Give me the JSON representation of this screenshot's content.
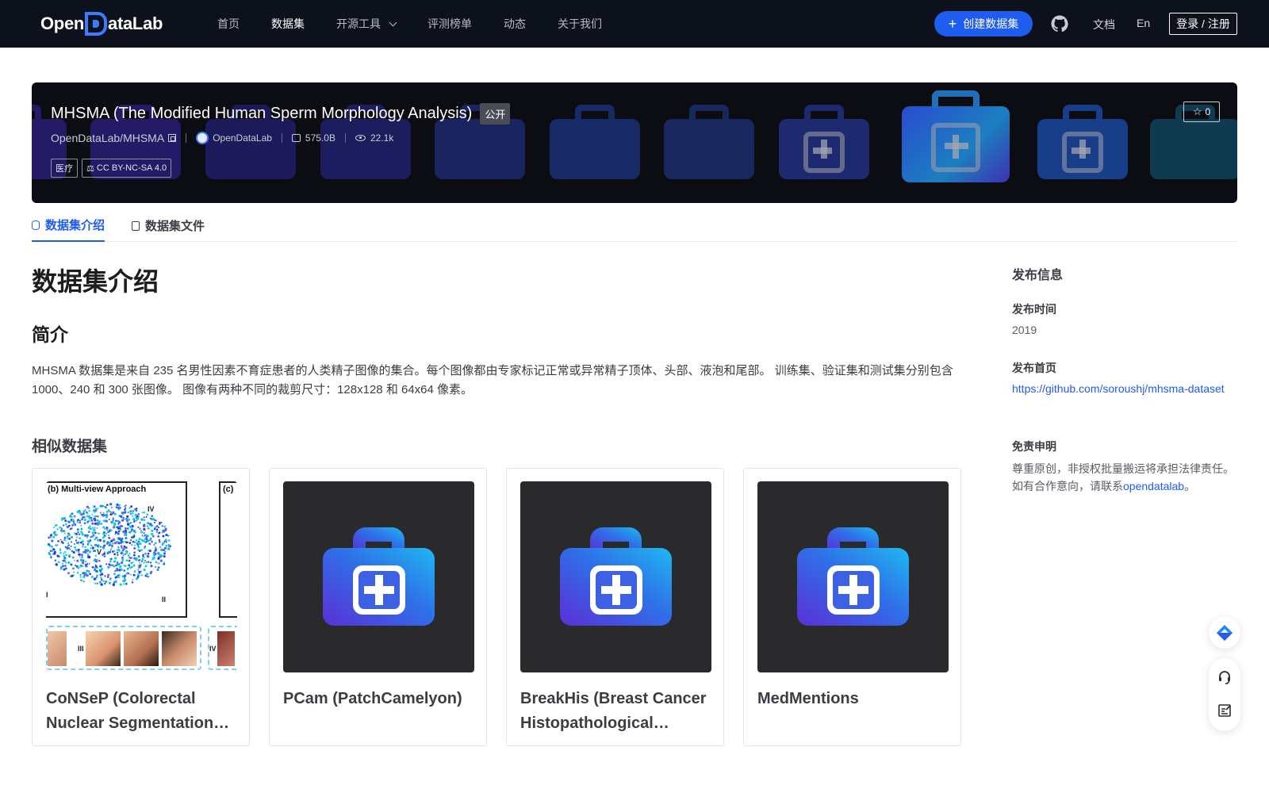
{
  "nav": {
    "logo_prefix": "Open",
    "logo_suffix": "ataLab",
    "links": [
      {
        "label": "首页"
      },
      {
        "label": "数据集"
      },
      {
        "label": "开源工具"
      },
      {
        "label": "评测榜单"
      },
      {
        "label": "动态"
      },
      {
        "label": "关于我们"
      }
    ],
    "create_label": "创建数据集",
    "docs_label": "文档",
    "lang_label": "En",
    "login_label": "登录 / 注册"
  },
  "banner": {
    "title": "MHSMA (The Modified Human Sperm Morphology Analysis)",
    "visibility": "公开",
    "repo": "OpenDataLab/MHSMA",
    "org": "OpenDataLab",
    "size": "575.0B",
    "views": "22.1k",
    "tags": [
      "医疗",
      "CC BY-NC-SA 4.0"
    ],
    "stars": "0"
  },
  "tabs": [
    {
      "label": "数据集介绍",
      "icon": "database-icon"
    },
    {
      "label": "数据集文件",
      "icon": "file-icon"
    }
  ],
  "content": {
    "heading": "数据集介绍",
    "intro_heading": "简介",
    "intro_text": "MHSMA 数据集是来自 235 名男性因素不育症患者的人类精子图像的集合。每个图像都由专家标记正常或异常精子顶体、头部、液泡和尾部。 训练集、验证集和测试集分别包含 1000、240 和 300 张图像。 图像有两种不同的裁剪尺寸：128x128 和 64x64 像素。",
    "similar_heading": "相似数据集",
    "cards": [
      {
        "title": "CoNSeP (Colorectal Nuclear Segmentation and Phenotypes)",
        "thumb": "figure"
      },
      {
        "title": "PCam (PatchCamelyon)",
        "thumb": "medical-kit-icon"
      },
      {
        "title": "BreakHis (Breast Cancer Histopathological Database)",
        "thumb": "medical-kit-icon"
      },
      {
        "title": "MedMentions",
        "thumb": "medical-kit-icon"
      }
    ],
    "figure_labels": {
      "panel_b": "(b) Multi-view Approach",
      "panel_c": "(c)",
      "roman": [
        "IV",
        "V",
        "I",
        "II",
        "III",
        "IV"
      ]
    }
  },
  "sidebar": {
    "publish_heading": "发布信息",
    "date_label": "发布时间",
    "date_value": "2019",
    "homepage_label": "发布首页",
    "homepage_url": "https://github.com/soroushj/mhsma-dataset",
    "disclaimer_label": "免责申明",
    "disclaimer_line1": "尊重原创，非授权批量搬运将承担法律责任。",
    "disclaimer_line2_prefix": "如有合作意向，请联系",
    "disclaimer_link": "opendatalab",
    "disclaimer_line2_suffix": "。"
  },
  "colors": {
    "accent": "#1f5cf0",
    "nav_bg": "#0d111c",
    "banner_bg": "#0b0d13"
  }
}
